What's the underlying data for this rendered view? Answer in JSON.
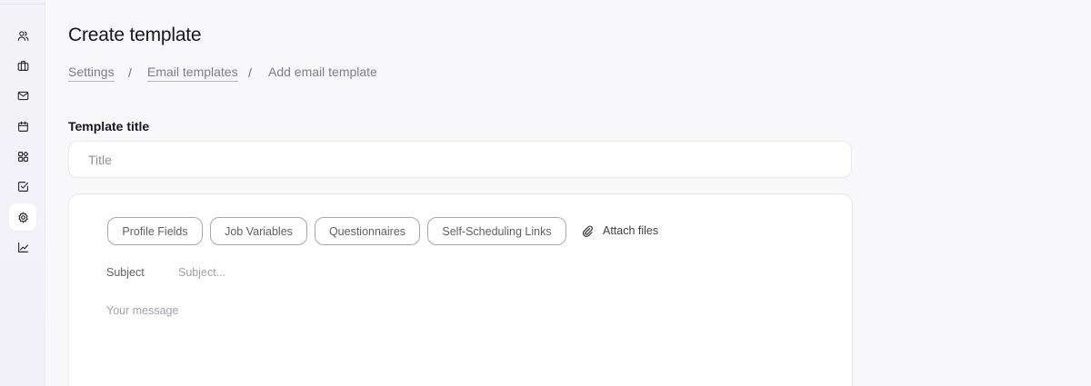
{
  "sidebar": {
    "items": [
      {
        "icon": "users-icon",
        "label": "Candidates"
      },
      {
        "icon": "briefcase-icon",
        "label": "Jobs"
      },
      {
        "icon": "mail-icon",
        "label": "Messages"
      },
      {
        "icon": "calendar-icon",
        "label": "Calendar"
      },
      {
        "icon": "widgets-icon",
        "label": "Apps"
      },
      {
        "icon": "checkbox-icon",
        "label": "Tasks"
      },
      {
        "icon": "gear-icon",
        "label": "Settings",
        "active": true
      },
      {
        "icon": "chart-icon",
        "label": "Reports"
      }
    ]
  },
  "page": {
    "title": "Create template"
  },
  "breadcrumb": {
    "items": [
      "Settings",
      "Email templates",
      "Add email template"
    ],
    "separator": "/"
  },
  "form": {
    "title_label": "Template title",
    "title_placeholder": "Title",
    "title_value": ""
  },
  "editor": {
    "chips": [
      "Profile Fields",
      "Job Variables",
      "Questionnaires",
      "Self-Scheduling Links"
    ],
    "attach_label": "Attach files",
    "subject_label": "Subject",
    "subject_placeholder": "Subject...",
    "message_placeholder": "Your message"
  },
  "colors": {
    "background": "#f8f8fb",
    "surface": "#ffffff",
    "border": "#e8e8ee",
    "text_primary": "#16161d",
    "text_muted": "#7b7d88"
  }
}
